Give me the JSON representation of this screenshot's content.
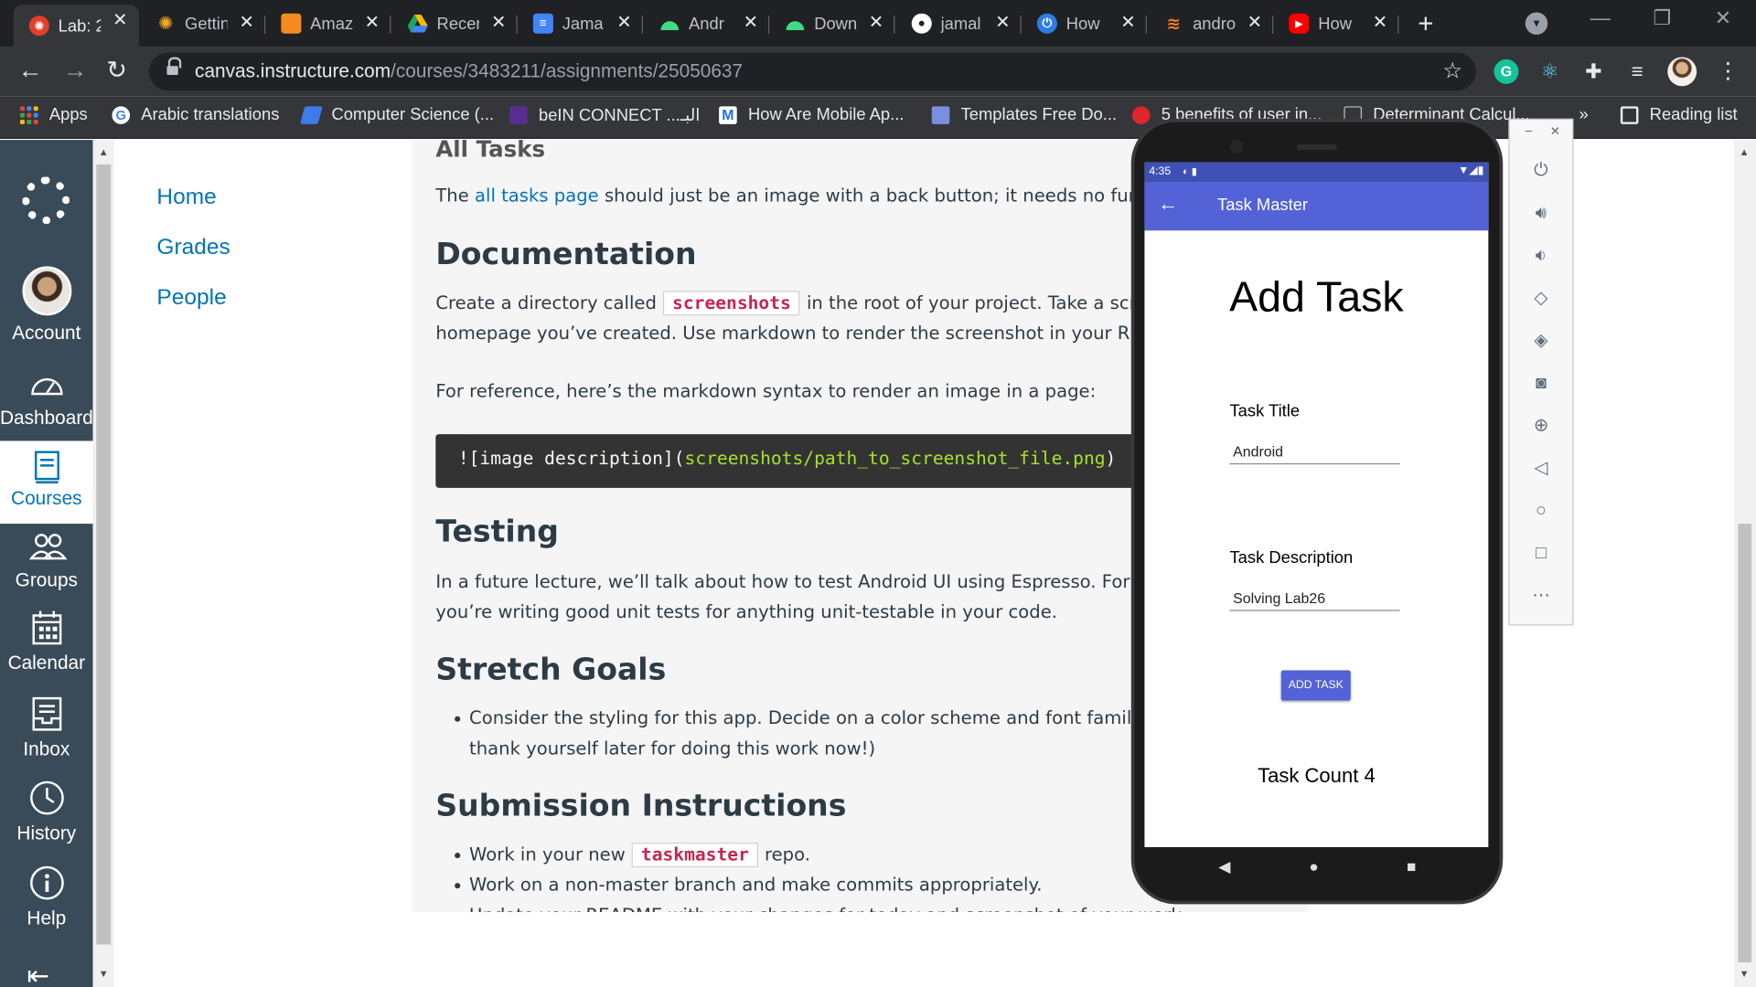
{
  "browser": {
    "tabs": [
      {
        "title": "Lab: 2",
        "icon": "canvas-icon",
        "color": "#e13f2b"
      },
      {
        "title": "Gettin",
        "icon": "sun-icon",
        "color": "#f5a623"
      },
      {
        "title": "Amaz",
        "icon": "cube-icon",
        "color": "#f58a1f"
      },
      {
        "title": "Recen",
        "icon": "drive-icon",
        "color": "#1fa463"
      },
      {
        "title": "Jama",
        "icon": "docs-icon",
        "color": "#4285f4"
      },
      {
        "title": "Andr",
        "icon": "android-icon",
        "color": "#3ddc84"
      },
      {
        "title": "Down",
        "icon": "android-icon",
        "color": "#3ddc84"
      },
      {
        "title": "jamal",
        "icon": "github-icon",
        "color": "#ffffff"
      },
      {
        "title": "How",
        "icon": "power-icon",
        "color": "#2e7ce5"
      },
      {
        "title": "andro",
        "icon": "stack-overflow-icon",
        "color": "#f48024"
      },
      {
        "title": "How",
        "icon": "youtube-icon",
        "color": "#ff0000"
      }
    ],
    "url_host": "canvas.instructure.com",
    "url_path": "/courses/3483211/assignments/25050637",
    "bookmarks": [
      {
        "label": "Apps"
      },
      {
        "label": "Arabic translations"
      },
      {
        "label": "Computer Science (..."
      },
      {
        "label": "beIN CONNECT ...البـ"
      },
      {
        "label": "How Are Mobile Ap..."
      },
      {
        "label": "Templates Free Do..."
      },
      {
        "label": "5 benefits of user in..."
      },
      {
        "label": "Determinant Calcul..."
      }
    ],
    "reading_list": "Reading list",
    "more_bookmarks": "»"
  },
  "global_nav": {
    "account": "Account",
    "dashboard": "Dashboard",
    "courses": "Courses",
    "groups": "Groups",
    "calendar": "Calendar",
    "inbox": "Inbox",
    "history": "History",
    "help": "Help"
  },
  "course_nav": [
    "Home",
    "Grades",
    "People"
  ],
  "content": {
    "all_tasks_heading": "All Tasks",
    "all_tasks_pre": "The ",
    "all_tasks_link": "all tasks page",
    "all_tasks_post": " should just be an image with a back button; it needs no functionality.",
    "doc_heading": "Documentation",
    "doc_pre": "Create a directory called",
    "doc_code": "screenshots",
    "doc_post": "in the root of your project. Take a screenshot of the",
    "doc_line2": "homepage you’ve created. Use markdown to render the screenshot in your README.",
    "ref_line": "For reference, here’s the markdown syntax to render an image in a page:",
    "code_plain": "![image description](",
    "code_path": "screenshots/path_to_screenshot_file.png",
    "code_close": ")",
    "testing_heading": "Testing",
    "testing_line1": "In a future lecture, we’ll talk about how to test Android UI using Espresso. For now, ensure",
    "testing_line2": "you’re writing good unit tests for anything unit-testable in your code.",
    "stretch_heading": "Stretch Goals",
    "stretch_line1": "Consider the styling for this app. Decide on a color scheme and font families to use. (You’ll",
    "stretch_line2": "thank yourself later for doing this work now!)",
    "submission_heading": "Submission Instructions",
    "sub_b1_pre": "Work in your new",
    "sub_b1_code": "taskmaster",
    "sub_b1_post": "repo.",
    "sub_b2": "Work on a non-master branch and make commits appropriately.",
    "sub_b3": "Update your README with your changes for today and screenshot of your work."
  },
  "emulator": {
    "status_time": "4:35",
    "app_title": "Task Master",
    "heading": "Add Task",
    "task_title_label": "Task Title",
    "task_title_value": "Android",
    "task_desc_label": "Task Description",
    "task_desc_value": "Solving Lab26",
    "add_button": "ADD TASK",
    "task_count": "Task Count 4",
    "accent": "#5363d7"
  }
}
